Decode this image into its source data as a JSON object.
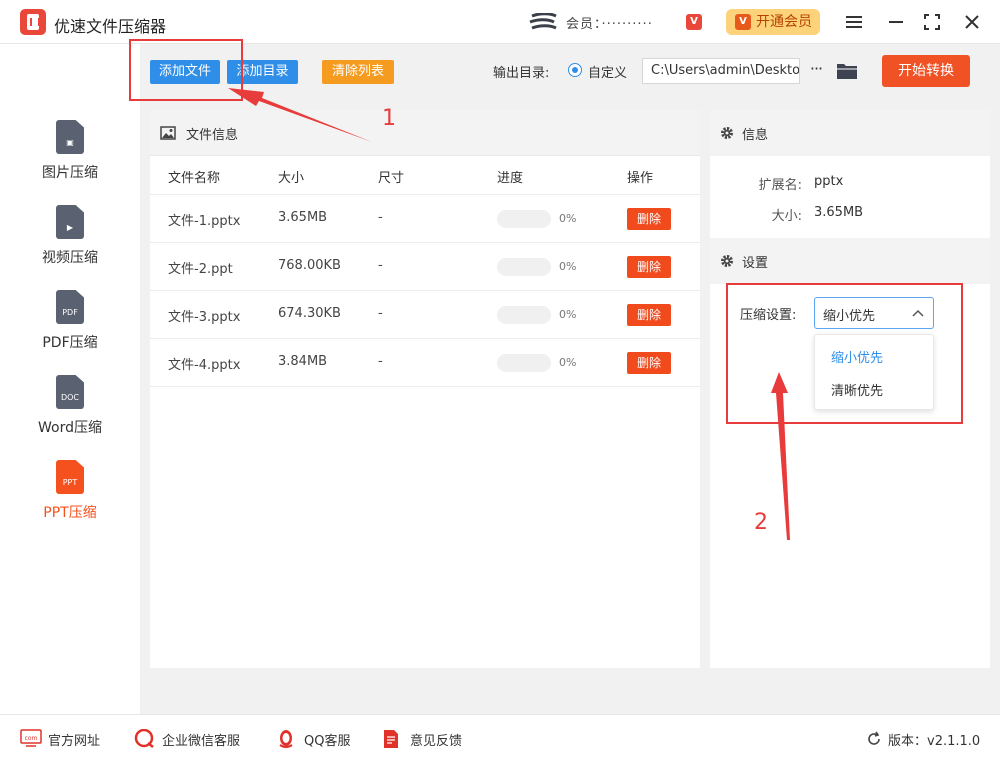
{
  "app": {
    "title": "优速文件压缩器",
    "user_label": "会员：··········",
    "vip_button": "开通会员"
  },
  "colors": {
    "accent": "#2f8ee8",
    "primary_orange": "#f05125",
    "annotation_red": "#e83c3c"
  },
  "sidebar": {
    "items": [
      {
        "label": "图片压缩",
        "icon": "image-file-icon",
        "tag": "▣"
      },
      {
        "label": "视频压缩",
        "icon": "video-file-icon",
        "tag": "▶"
      },
      {
        "label": "PDF压缩",
        "icon": "pdf-file-icon",
        "tag": "PDF"
      },
      {
        "label": "Word压缩",
        "icon": "doc-file-icon",
        "tag": "DOC"
      },
      {
        "label": "PPT压缩",
        "icon": "ppt-file-icon",
        "tag": "PPT",
        "active": true
      }
    ]
  },
  "toolbar": {
    "add_file": "添加文件",
    "add_folder": "添加目录",
    "clear_list": "清除列表",
    "output_label": "输出目录:",
    "output_option": "自定义",
    "output_path": "C:\\Users\\admin\\Desktop",
    "more": "···",
    "start": "开始转换"
  },
  "file_panel": {
    "title": "文件信息",
    "columns": [
      "文件名称",
      "大小",
      "尺寸",
      "进度",
      "操作"
    ],
    "rows": [
      {
        "name": "文件-1.pptx",
        "size": "3.65MB",
        "dim": "-",
        "progress": 0,
        "pct": "0%",
        "action": "删除"
      },
      {
        "name": "文件-2.ppt",
        "size": "768.00KB",
        "dim": "-",
        "progress": 0,
        "pct": "0%",
        "action": "删除"
      },
      {
        "name": "文件-3.pptx",
        "size": "674.30KB",
        "dim": "-",
        "progress": 0,
        "pct": "0%",
        "action": "删除"
      },
      {
        "name": "文件-4.pptx",
        "size": "3.84MB",
        "dim": "-",
        "progress": 0,
        "pct": "0%",
        "action": "删除"
      }
    ]
  },
  "info_panel": {
    "info_title": "信息",
    "ext_label": "扩展名:",
    "ext_value": "pptx",
    "size_label": "大小:",
    "size_value": "3.65MB",
    "settings_title": "设置",
    "compress_label": "压缩设置:",
    "compress_value": "缩小优先",
    "options": [
      "缩小优先",
      "清晰优先"
    ]
  },
  "annotations": {
    "one": "1",
    "two": "2"
  },
  "footer": {
    "website": "官方网址",
    "wechat": "企业微信客服",
    "qq": "QQ客服",
    "feedback": "意见反馈",
    "version": "版本：v2.1.1.0"
  }
}
